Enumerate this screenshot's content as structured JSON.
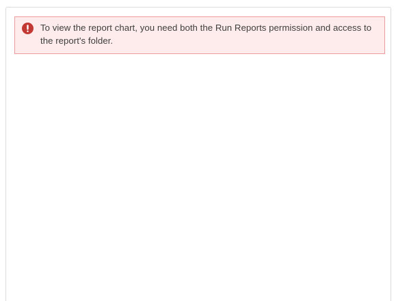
{
  "error_alert": {
    "icon": "error-icon",
    "icon_color": "#c23934",
    "message": "To view the report chart, you need both the Run Reports permission and access to the report's folder."
  }
}
